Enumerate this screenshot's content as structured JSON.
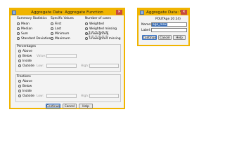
{
  "dialog1": {
    "title": "Aggregate Data: Aggregate Function",
    "sections": {
      "summary_statistics": "Summary Statistics",
      "specific_values": "Specific Values",
      "number_of_cases": "Number of cases",
      "percentages": "Percentages",
      "fractions": "Fractions"
    },
    "summary_options": [
      "Mean",
      "Median",
      "Sum",
      "Standard Deviation"
    ],
    "specific_options": [
      "First",
      "Last",
      "Minimum",
      "Maximum"
    ],
    "cases_options": [
      "Weighted",
      "Weighted missing",
      "Unweighted",
      "Unweighted missing"
    ],
    "selected_cases_option": "Unweighted",
    "percentages_options": [
      "Above",
      "Below",
      "Inside",
      "Outside"
    ],
    "fractions_options": [
      "Above",
      "Below",
      "Inside",
      "Outside"
    ],
    "value_label": "Value:",
    "low_label": "Low:",
    "high_label": "High:",
    "buttons": {
      "continue": "Continue",
      "cancel": "Cancel",
      "help": "Help"
    }
  },
  "dialog2": {
    "title": "Aggregate Data: Variabl...",
    "current_variable": "POUTAge 20 24)",
    "name_label": "Name:",
    "name_value": "age_max",
    "label_label": "Label:",
    "label_value": "",
    "buttons": {
      "continue": "Continue",
      "cancel": "Cancel",
      "help": "Help"
    }
  },
  "colors": {
    "title_bar": "#f0b400",
    "selection": "#3d6fb5",
    "close": "#c84b3e"
  }
}
